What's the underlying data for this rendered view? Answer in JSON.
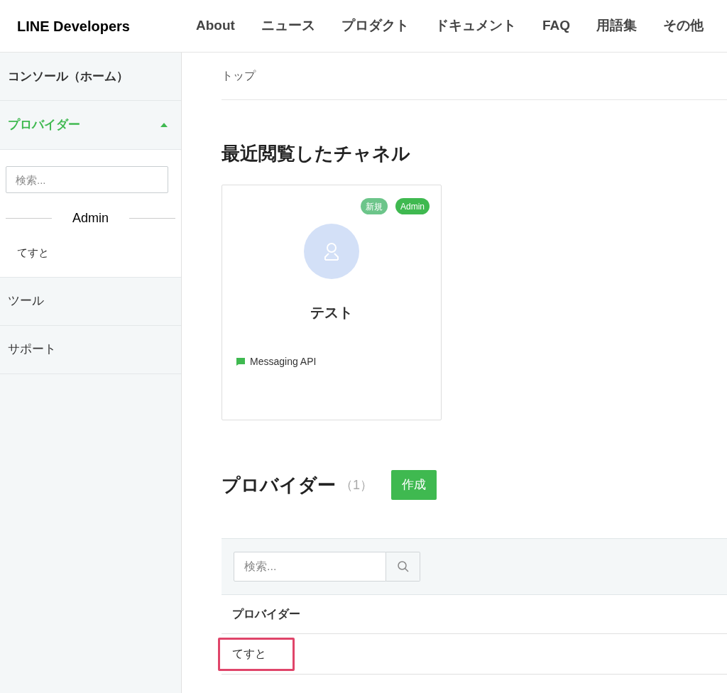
{
  "header": {
    "logo": "LINE Developers",
    "nav": [
      "About",
      "ニュース",
      "プロダクト",
      "ドキュメント",
      "FAQ",
      "用語集",
      "その他"
    ]
  },
  "sidebar": {
    "items": [
      {
        "label": "コンソール（ホーム）",
        "kind": "link",
        "selected": false
      },
      {
        "label": "プロバイダー",
        "kind": "section",
        "selected": true,
        "expanded": true,
        "search": {
          "placeholder": "検索..."
        },
        "group": "Admin",
        "entries": [
          "てすと"
        ]
      },
      {
        "label": "ツール",
        "kind": "link",
        "selected": false
      },
      {
        "label": "サポート",
        "kind": "link",
        "selected": false
      }
    ]
  },
  "breadcrumb": "トップ",
  "recent": {
    "title": "最近閲覧したチャネル",
    "channels": [
      {
        "badges": [
          {
            "label": "新規",
            "color": "#6cc58a"
          },
          {
            "label": "Admin",
            "color": "#3fb950"
          }
        ],
        "name": "テスト",
        "type": "Messaging API"
      }
    ]
  },
  "providers": {
    "title": "プロバイダー",
    "count": "（1）",
    "create_button": "作成",
    "search": {
      "placeholder": "検索..."
    },
    "table": {
      "columns": [
        "プロバイダー"
      ],
      "rows": [
        {
          "name": "てすと",
          "highlighted": true
        }
      ]
    }
  }
}
